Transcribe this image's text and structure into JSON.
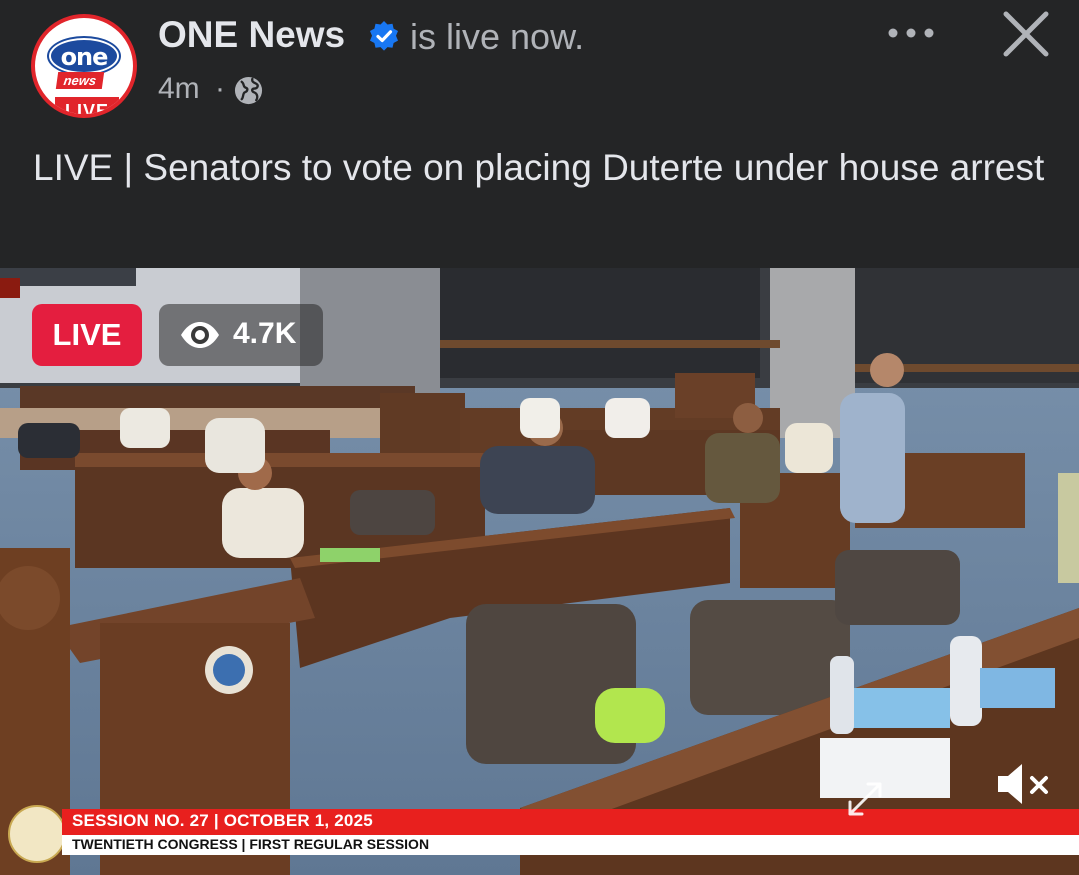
{
  "post": {
    "page_name": "ONE News",
    "status_text": "is live now.",
    "time": "4m",
    "separator": "·",
    "title": "LIVE | Senators to vote on placing Duterte under house arrest",
    "avatar": {
      "logo_top": "one",
      "logo_middle": "news",
      "logo_bottom": "LIVE"
    }
  },
  "icons": {
    "verified": "verified-badge-icon",
    "privacy": "globe-icon",
    "more": "more-options-icon",
    "close": "close-icon",
    "viewers": "eye-icon",
    "mute": "muted-speaker-icon",
    "expand": "expand-icon"
  },
  "video": {
    "live_label": "LIVE",
    "viewer_count": "4.7K",
    "lower_third": {
      "line1": "SESSION NO. 27 | OCTOBER 1, 2025",
      "line2": "TWENTIETH CONGRESS | FIRST REGULAR SESSION"
    }
  },
  "colors": {
    "background": "#242526",
    "text_primary": "#e4e6eb",
    "text_secondary": "#b0b3b8",
    "verified_blue": "#1877f2",
    "live_red": "#e41e3f",
    "lower_third_red": "#e8201e"
  }
}
